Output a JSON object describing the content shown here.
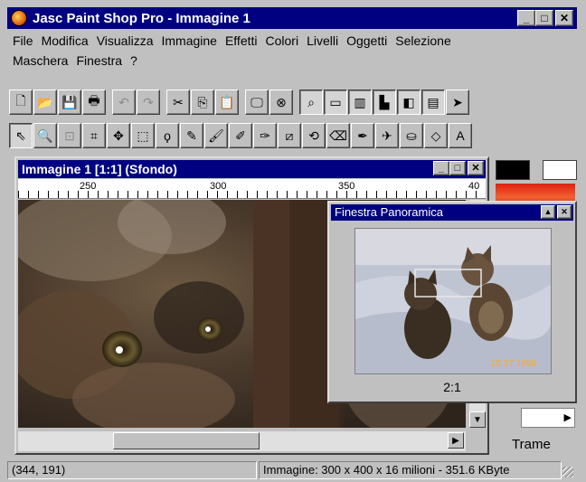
{
  "app": {
    "title": "Jasc Paint Shop Pro - Immagine 1",
    "controls": {
      "minimize": "_",
      "maximize": "□",
      "close": "✕"
    }
  },
  "menu": [
    "File",
    "Modifica",
    "Visualizza",
    "Immagine",
    "Effetti",
    "Colori",
    "Livelli",
    "Oggetti",
    "Selezione",
    "Maschera",
    "Finestra",
    "?"
  ],
  "toolbar1": [
    {
      "name": "new-icon",
      "glyph": "🗋"
    },
    {
      "name": "open-icon",
      "glyph": "📂"
    },
    {
      "name": "save-icon",
      "glyph": "💾"
    },
    {
      "name": "print-icon",
      "glyph": "🖶"
    },
    {
      "name": "undo-icon",
      "glyph": "↶",
      "disabled": true
    },
    {
      "name": "redo-icon",
      "glyph": "↷",
      "disabled": true
    },
    {
      "name": "cut-icon",
      "glyph": "✂"
    },
    {
      "name": "copy-icon",
      "glyph": "⎘"
    },
    {
      "name": "paste-icon",
      "glyph": "📋"
    },
    {
      "name": "full-screen-icon",
      "glyph": "🖵"
    },
    {
      "name": "overview-icon",
      "glyph": "⊗"
    },
    {
      "name": "tool-palette-icon",
      "glyph": "⌕",
      "pressed": true
    },
    {
      "name": "style-bar-icon",
      "glyph": "▭",
      "pressed": true
    },
    {
      "name": "color-palette-icon",
      "glyph": "▥",
      "pressed": true
    },
    {
      "name": "histogram-icon",
      "glyph": "▙",
      "pressed": true
    },
    {
      "name": "layer-palette-icon",
      "glyph": "◧",
      "pressed": true
    },
    {
      "name": "tool-options-icon",
      "glyph": "▤",
      "pressed": true
    },
    {
      "name": "pointer-icon",
      "glyph": "➤"
    }
  ],
  "toolbar2": [
    {
      "name": "select-arrow-icon",
      "glyph": "⇖",
      "pressed": true
    },
    {
      "name": "zoom-icon",
      "glyph": "🔍"
    },
    {
      "name": "deformation-icon",
      "glyph": "⊡",
      "disabled": true
    },
    {
      "name": "crop-icon",
      "glyph": "⌗"
    },
    {
      "name": "move-icon",
      "glyph": "✥"
    },
    {
      "name": "selection-icon",
      "glyph": "⬚"
    },
    {
      "name": "freehand-icon",
      "glyph": "ϙ"
    },
    {
      "name": "dropper-icon",
      "glyph": "✎"
    },
    {
      "name": "paintbrush-icon",
      "glyph": "🖌"
    },
    {
      "name": "clone-brush-icon",
      "glyph": "✐"
    },
    {
      "name": "color-replacer-icon",
      "glyph": "✑"
    },
    {
      "name": "retouch-icon",
      "glyph": "⧄"
    },
    {
      "name": "scratch-remover-icon",
      "glyph": "⟲"
    },
    {
      "name": "eraser-icon",
      "glyph": "⌫"
    },
    {
      "name": "picture-tube-icon",
      "glyph": "✒"
    },
    {
      "name": "airbrush-icon",
      "glyph": "✈"
    },
    {
      "name": "flood-fill-icon",
      "glyph": "⛀"
    },
    {
      "name": "shape-icon",
      "glyph": "◇"
    },
    {
      "name": "text-icon",
      "glyph": "A"
    }
  ],
  "image_window": {
    "title": "Immagine 1 [1:1] (Sfondo)",
    "ruler_labels": [
      "250",
      "300",
      "350",
      "40"
    ]
  },
  "panorama": {
    "title": "Finestra Panoramica",
    "zoom": "2:1",
    "date_stamp": "10 27 1998"
  },
  "palette": {
    "foreground": "#000000",
    "background": "#ffffff",
    "texture_label": "Trame"
  },
  "status": {
    "coords": "(344, 191)",
    "image_info": "Immagine:  300 x 400 x 16 milioni - 351.6 KByte"
  },
  "colors": {
    "titlebar": "#000080",
    "face": "#c0c0c0"
  }
}
